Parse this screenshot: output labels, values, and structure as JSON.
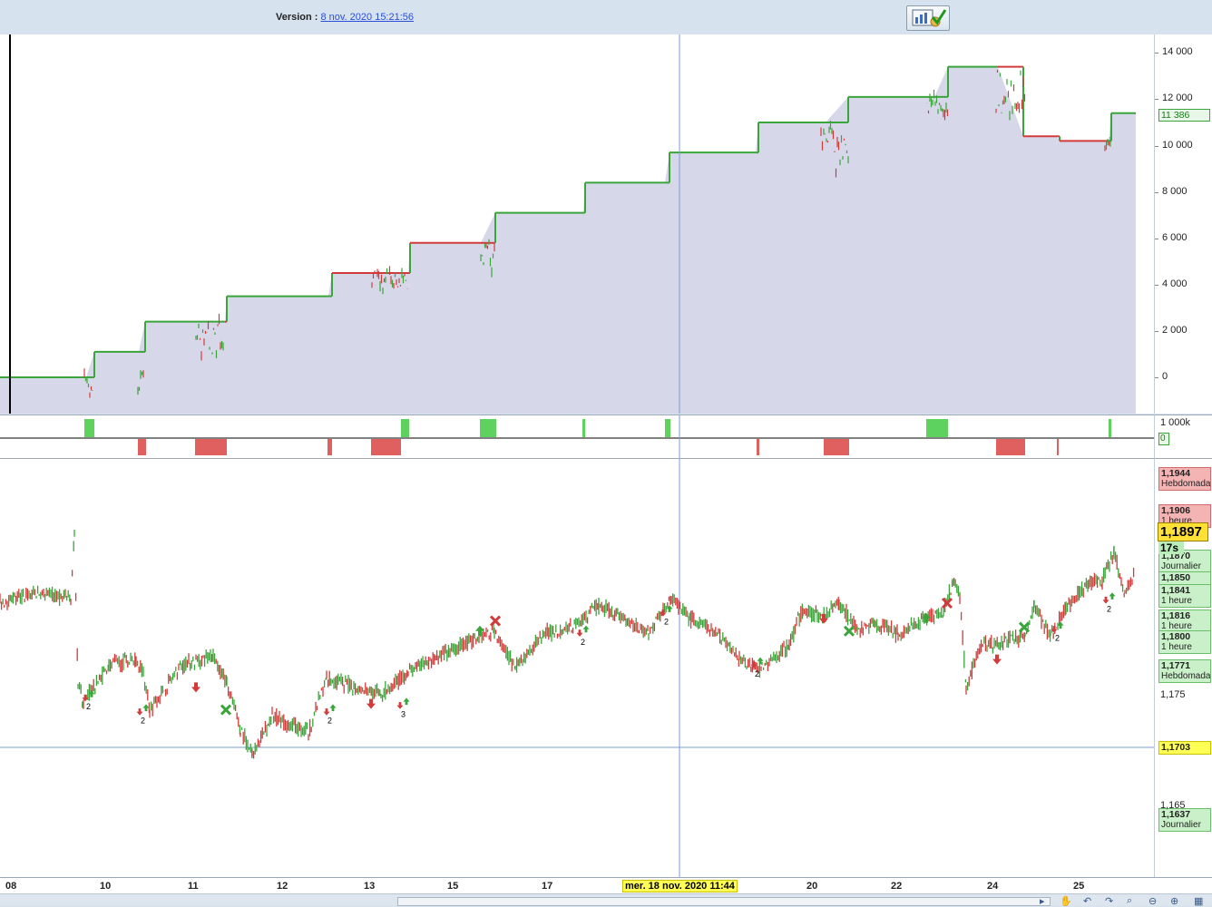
{
  "header": {
    "version_label": "Version :",
    "version_link": "8 nov. 2020 15:21:56"
  },
  "equity_axis": {
    "ticks": [
      "14 000",
      "12 000",
      "10 000",
      "8 000",
      "6 000",
      "4 000",
      "2 000",
      "0"
    ],
    "last_value": "11 386"
  },
  "volume_axis": {
    "top": "1 000k",
    "zero": "0"
  },
  "price_axis": {
    "ticks": [
      "1,175",
      "1,165"
    ],
    "current": "1,1897",
    "timer": "17s",
    "levels": [
      {
        "price": "1,1944",
        "label": "Hebdomadaire",
        "kind": "res"
      },
      {
        "price": "1,1906",
        "label": "1 heure",
        "kind": "res"
      },
      {
        "price": "1,1870",
        "label": "Journalier",
        "kind": "sup"
      },
      {
        "price": "1,1850",
        "label": "",
        "kind": "sup"
      },
      {
        "price": "1,1841",
        "label": "1 heure",
        "kind": "sup"
      },
      {
        "price": "1,1816",
        "label": "1 heure",
        "kind": "sup"
      },
      {
        "price": "1,1800",
        "label": "1 heure",
        "kind": "sup"
      },
      {
        "price": "1,1771",
        "label": "Hebdomadaire",
        "kind": "sup"
      },
      {
        "price": "1,1703",
        "label": "",
        "kind": "cursor"
      },
      {
        "price": "1,1637",
        "label": "Journalier",
        "kind": "sup"
      }
    ]
  },
  "x_axis": {
    "labels": [
      "08",
      "10",
      "11",
      "12",
      "13",
      "15",
      "17",
      "20",
      "22",
      "24",
      "25"
    ],
    "cursor_label": "mer. 18 nov. 2020 11:44"
  },
  "markers": {
    "counts": [
      "2",
      "2",
      "2",
      "3",
      "2",
      "2",
      "2",
      "2",
      "2"
    ]
  },
  "colors": {
    "up": "#3aa53a",
    "down": "#d23b3b",
    "area": "#d7d7ea",
    "volume_up": "#5ed25e",
    "volume_down": "#e06060"
  }
}
